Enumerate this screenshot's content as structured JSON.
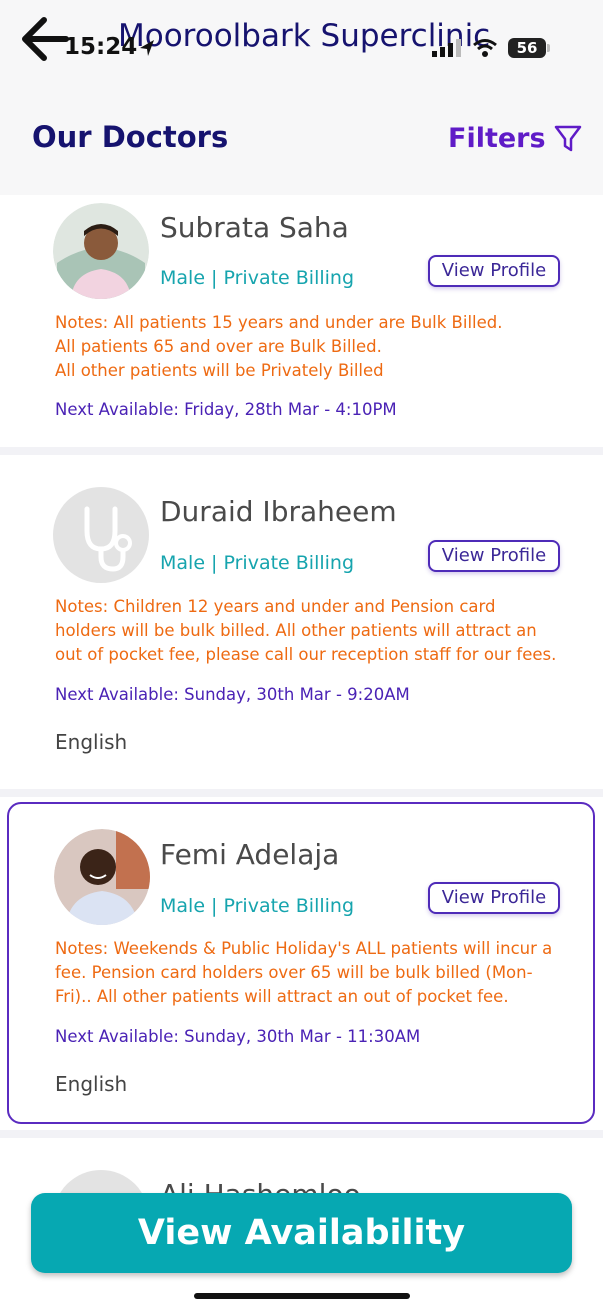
{
  "status_bar": {
    "time": "15:24",
    "battery": "56"
  },
  "nav": {
    "clinic_name": "Mooroolbark Superclinic"
  },
  "header": {
    "title": "Our Doctors",
    "filters_label": "Filters"
  },
  "doctors": [
    {
      "name": "Subrata Saha",
      "meta": "Male | Private Billing",
      "profile_button": "View Profile",
      "notes": [
        "Notes: All patients 15 years and under are Bulk Billed.",
        "All patients 65 and over are Bulk Billed.",
        "All other patients will be Privately Billed"
      ],
      "next_available": "Next Available: Friday, 28th Mar - 4:10PM"
    },
    {
      "name": "Duraid Ibraheem",
      "meta": "Male | Private Billing",
      "profile_button": "View Profile",
      "notes": [
        "Notes: Children 12 years and under and Pension card",
        "holders will be bulk billed. All other patients will attract an",
        "out of pocket fee, please call our reception staff for our fees."
      ],
      "next_available": "Next Available: Sunday, 30th Mar - 9:20AM",
      "language": "English"
    },
    {
      "name": "Femi Adelaja",
      "meta": "Male | Private Billing",
      "profile_button": "View Profile",
      "notes": [
        "Notes: Weekends & Public Holiday's ALL patients will incur a",
        "fee. Pension card holders over 65 will be bulk billed (Mon-",
        "Fri).. All other patients will attract an out of pocket fee."
      ],
      "next_available": "Next Available: Sunday, 30th Mar - 11:30AM",
      "language": "English"
    },
    {
      "name": "Ali Hashemloo"
    }
  ],
  "cta": {
    "label": "View Availability"
  },
  "colors": {
    "brand_navy": "#16136f",
    "purple": "#5f1bc7",
    "teal": "#06a8b2",
    "orange": "#ee6a12"
  }
}
